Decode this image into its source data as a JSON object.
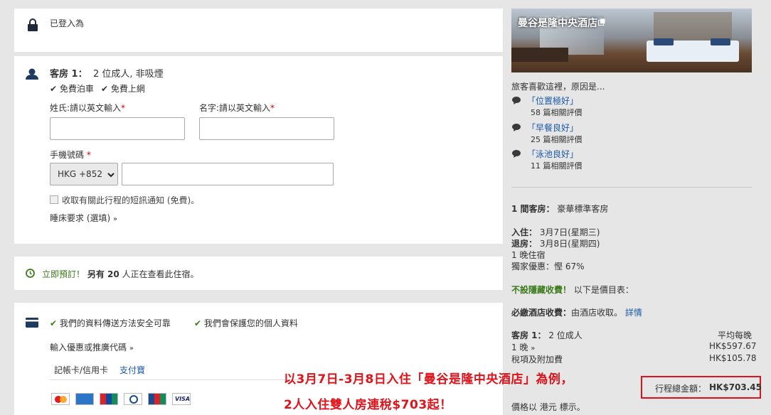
{
  "login": {
    "text": "已登入為"
  },
  "room": {
    "title": "客房 1：",
    "desc": "2 位成人, 非吸煙",
    "perk1": "免費泊車",
    "perk2": "免費上網",
    "surname_label": "姓氏:請以英文輸入",
    "given_label": "名字:請以英文輸入",
    "required_mark": "*",
    "phone_label": "手機號碼",
    "country_code": "HKG +852",
    "sms_label": "收取有關此行程的短訊通知 (免費)。",
    "bed_request": "睡床要求 (選填)"
  },
  "urgency": {
    "lead": "立即預訂！",
    "mid": "另有 ",
    "count": "20",
    "tail": " 人正在查看此住宿。"
  },
  "payment": {
    "secure1": "我們的資料傳送方法安全可靠",
    "secure2": "我們會保護您的個人資料",
    "promo": "輸入優惠或推廣代碼",
    "tab_card": "記帳卡/信用卡",
    "tab_alipay": "支付寶",
    "card_logos": [
      "mastercard",
      "amex",
      "unionpay",
      "diners",
      "jcb",
      "visa"
    ]
  },
  "hotel": {
    "name": "曼谷是隆中央酒店",
    "likes_title": "旅客喜歡這裡，原因是...",
    "reviews": [
      {
        "title": "「位置極好」",
        "count": "58 篇相關評價"
      },
      {
        "title": "「早餐良好」",
        "count": "25 篇相關評價"
      },
      {
        "title": "「泳池良好」",
        "count": "11 篇相關評價"
      }
    ]
  },
  "summary": {
    "rooms_count": "1 間客房：",
    "room_type": "豪華標準客房",
    "checkin_label": "入住：",
    "checkin": "3月7日(星期三)",
    "checkout_label": "退房：",
    "checkout": "3月8日(星期四)",
    "nights": "1 晚住宿",
    "discount": "獨家優惠：慳 67%",
    "no_hidden_bold": "不設隱藏收費！",
    "no_hidden_rest": " 以下是價目表：",
    "mandatory_bold": "必繳酒店收費：",
    "mandatory_rest": "由酒店收取。",
    "details_link": "詳情",
    "room1_label": "客房 1：",
    "room1_desc": "2 位成人",
    "avg_label": "平均每晚",
    "one_night": "1 晚",
    "one_night_price": "HK$597.67",
    "tax_label": "稅項及附加費",
    "tax_price": "HK$105.78",
    "total_label": "行程總金額：",
    "total_price": "HK$703.45",
    "currency_note": "價格以 港元 標示。"
  },
  "annotation": {
    "line1": "以3月7日-3月8日入住「曼谷是隆中央酒店」為例，",
    "line2": "2人入住雙人房連稅$703起！"
  }
}
